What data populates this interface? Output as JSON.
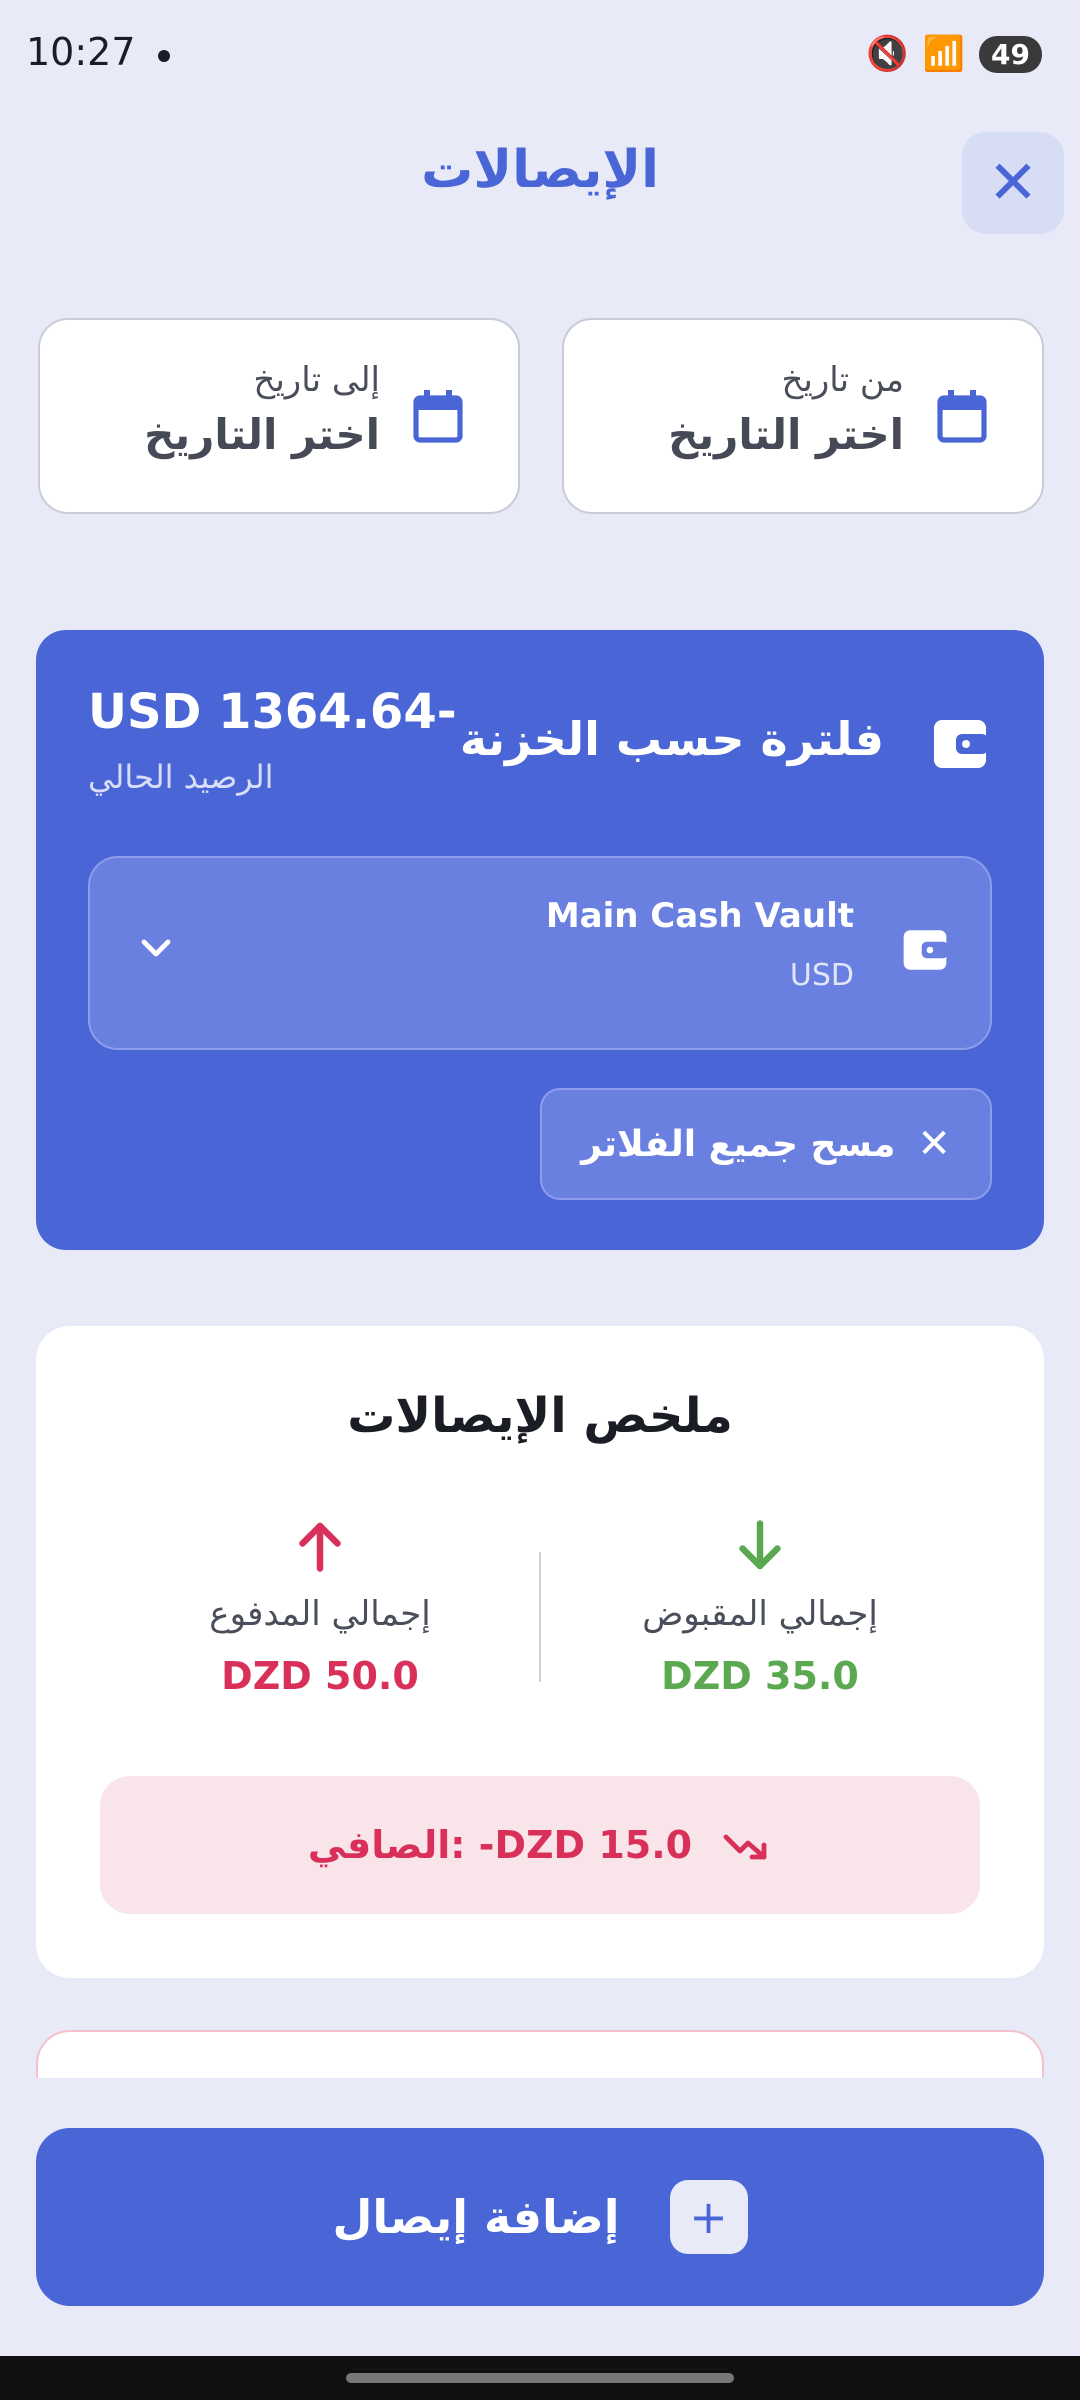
{
  "status_bar": {
    "time": "10:27",
    "battery": "49",
    "icons": [
      "mute-icon",
      "wifi-icon",
      "signal-icon",
      "battery-icon"
    ]
  },
  "header": {
    "title": "الإيصالات",
    "close_icon": "close-icon"
  },
  "date_filters": {
    "from": {
      "label": "من تاريخ",
      "value": "اختر التاريخ"
    },
    "to": {
      "label": "إلى تاريخ",
      "value": "اختر التاريخ"
    }
  },
  "vault_filter": {
    "title": "فلترة حسب الخزنة",
    "balance": "USD 1364.64-",
    "balance_label": "الرصيد الحالي",
    "selected_vault": {
      "name": "Main Cash Vault",
      "currency": "USD"
    },
    "clear_label": "مسح جميع الفلاتر"
  },
  "summary": {
    "title": "ملخص الإيصالات",
    "received": {
      "label": "إجمالي المقبوض",
      "amount": "DZD 35.0"
    },
    "paid": {
      "label": "إجمالي المدفوع",
      "amount": "DZD 50.0"
    },
    "net": "الصافي: -DZD 15.0"
  },
  "add_button": {
    "label": "إضافة إيصال"
  },
  "colors": {
    "primary": "#4a66d6",
    "received": "#5aa84f",
    "paid": "#d9305a",
    "background": "#e8ebf7"
  }
}
